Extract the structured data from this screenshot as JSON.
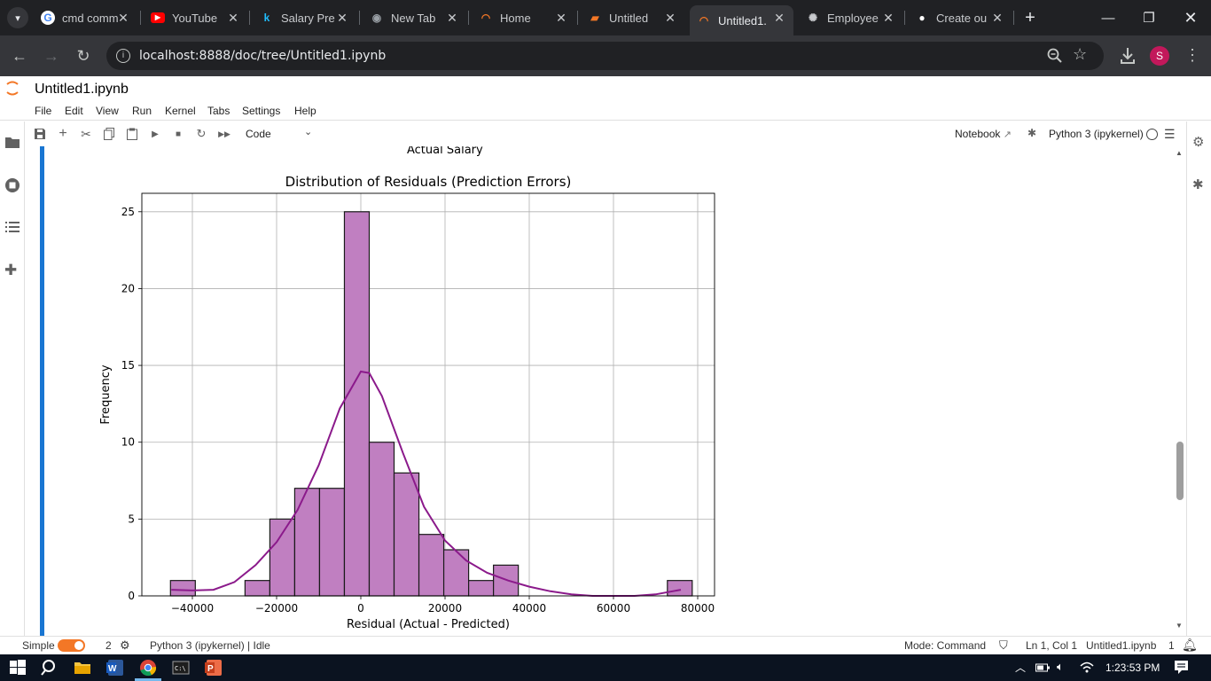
{
  "browser": {
    "tabs": [
      {
        "label": "cmd comm",
        "icon": "google-icon",
        "color": "#4285f4"
      },
      {
        "label": "YouTube",
        "icon": "youtube-icon",
        "color": "#ff0000"
      },
      {
        "label": "Salary Pre",
        "icon": "kaggle-icon",
        "color": "#20beff"
      },
      {
        "label": "New Tab",
        "icon": "chrome-newtab-icon",
        "color": "#9aa0a6"
      },
      {
        "label": "Home",
        "icon": "jupyter-icon",
        "color": "#f37726"
      },
      {
        "label": "Untitled",
        "icon": "notebook-icon",
        "color": "#f37726"
      },
      {
        "label": "Untitled1.",
        "icon": "jupyter-icon",
        "color": "#f37726"
      },
      {
        "label": "Employee",
        "icon": "openai-icon",
        "color": "#c8cacd"
      },
      {
        "label": "Create ou",
        "icon": "github-icon",
        "color": "#ffffff"
      }
    ],
    "url": "localhost:8888/doc/tree/Untitled1.ipynb",
    "profile_initial": "S",
    "profile_color": "#c2185b"
  },
  "jupyter": {
    "doc_title": "Untitled1.ipynb",
    "menu": [
      "File",
      "Edit",
      "View",
      "Run",
      "Kernel",
      "Tabs",
      "Settings",
      "Help"
    ],
    "cell_type": "Code",
    "notebook_label": "Notebook",
    "kernel_label": "Python 3 (ipykernel)",
    "prev_axis_label": "Actual Salary"
  },
  "status": {
    "simple_label": "Simple",
    "count": "2",
    "kernel_status": "Python 3 (ipykernel) | Idle",
    "mode": "Mode: Command",
    "position": "Ln 1, Col 1",
    "filename": "Untitled1.ipynb",
    "notif_count": "1"
  },
  "taskbar": {
    "time": "1:23:53 PM"
  },
  "chart_data": {
    "type": "bar",
    "title": "Distribution of Residuals (Prediction Errors)",
    "xlabel": "Residual (Actual - Predicted)",
    "ylabel": "Frequency",
    "xlim": [
      -52000,
      84000
    ],
    "ylim": [
      0,
      26.2
    ],
    "xticks": [
      -40000,
      -20000,
      0,
      20000,
      40000,
      60000,
      80000
    ],
    "xtick_labels": [
      "−40000",
      "−20000",
      "0",
      "20000",
      "40000",
      "60000",
      "80000"
    ],
    "yticks": [
      0,
      5,
      10,
      15,
      20,
      25
    ],
    "bin_edges": [
      -45200,
      -39300,
      -33400,
      -27500,
      -21600,
      -15700,
      -9800,
      -3900,
      2000,
      7900,
      13800,
      19700,
      25600,
      31500,
      37400,
      43300,
      49200,
      55100,
      61000,
      66900,
      72800,
      78700
    ],
    "counts": [
      1,
      0,
      0,
      1,
      5,
      7,
      7,
      25,
      10,
      8,
      4,
      3,
      1,
      2,
      0,
      0,
      0,
      0,
      0,
      0,
      1
    ],
    "kde": [
      [
        -45000,
        0.4
      ],
      [
        -40000,
        0.35
      ],
      [
        -35000,
        0.4
      ],
      [
        -30000,
        0.9
      ],
      [
        -25000,
        2.0
      ],
      [
        -20000,
        3.5
      ],
      [
        -15000,
        5.6
      ],
      [
        -10000,
        8.5
      ],
      [
        -5000,
        12.2
      ],
      [
        0,
        14.6
      ],
      [
        2000,
        14.5
      ],
      [
        5000,
        13.0
      ],
      [
        10000,
        9.3
      ],
      [
        15000,
        5.8
      ],
      [
        20000,
        3.6
      ],
      [
        25000,
        2.3
      ],
      [
        30000,
        1.5
      ],
      [
        35000,
        1.0
      ],
      [
        40000,
        0.6
      ],
      [
        45000,
        0.3
      ],
      [
        50000,
        0.1
      ],
      [
        55000,
        0.0
      ],
      [
        60000,
        0.0
      ],
      [
        65000,
        0.0
      ],
      [
        70000,
        0.1
      ],
      [
        76000,
        0.4
      ]
    ],
    "bar_color": "#c07fc1",
    "kde_color": "#8b1a8b",
    "grid": true
  }
}
